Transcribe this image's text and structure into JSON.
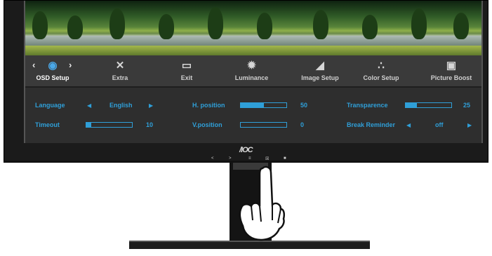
{
  "logo": "/IOC",
  "bezel_buttons": [
    "<",
    ">",
    "≡",
    "☒",
    "■"
  ],
  "tabs": [
    {
      "label": "OSD Setup",
      "icon": "globe-gear-icon",
      "active": true
    },
    {
      "label": "Extra",
      "icon": "tools-icon",
      "active": false
    },
    {
      "label": "Exit",
      "icon": "exit-door-icon",
      "active": false
    },
    {
      "label": "Luminance",
      "icon": "sun-icon",
      "active": false
    },
    {
      "label": "Image Setup",
      "icon": "image-adjust-icon",
      "active": false
    },
    {
      "label": "Color Setup",
      "icon": "color-dots-icon",
      "active": false
    },
    {
      "label": "Picture Boost",
      "icon": "picture-boost-icon",
      "active": false
    }
  ],
  "settings": {
    "language": {
      "label": "Language",
      "value": "English"
    },
    "timeout": {
      "label": "Timeout",
      "value": "10",
      "level": 0.1
    },
    "h_position": {
      "label": "H. position",
      "value": "50",
      "level": 0.5
    },
    "v_position": {
      "label": "V.position",
      "value": "0",
      "level": 0.0
    },
    "transparence": {
      "label": "Transparence",
      "value": "25",
      "level": 0.25
    },
    "break_reminder": {
      "label": "Break Reminder",
      "value": "off"
    }
  },
  "colors": {
    "accent": "#2f9fd8",
    "panel": "#2e2e2e",
    "bezel": "#1b1b1b"
  }
}
